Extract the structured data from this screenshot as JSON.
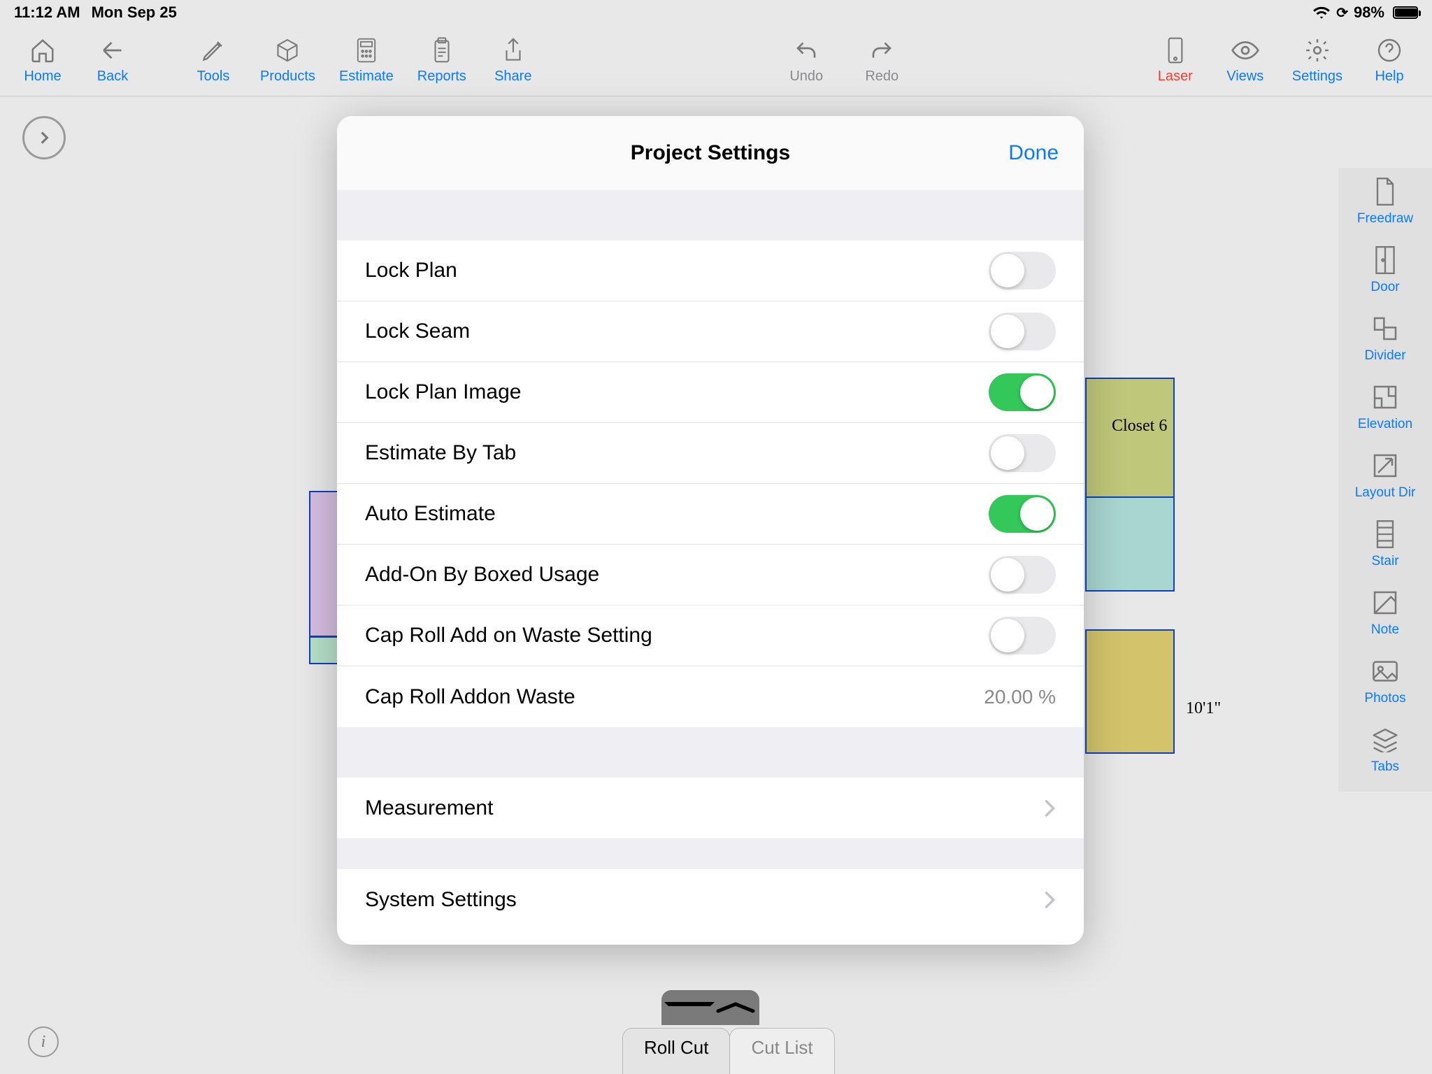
{
  "status": {
    "time": "11:12 AM",
    "date": "Mon Sep 25",
    "battery_pct": "98%"
  },
  "toolbar": {
    "home": "Home",
    "back": "Back",
    "tools": "Tools",
    "products": "Products",
    "estimate": "Estimate",
    "reports": "Reports",
    "share": "Share",
    "undo": "Undo",
    "redo": "Redo",
    "laser": "Laser",
    "views": "Views",
    "settings": "Settings",
    "help": "Help"
  },
  "rail": {
    "freedraw": "Freedraw",
    "door": "Door",
    "divider": "Divider",
    "elevation": "Elevation",
    "layoutdir": "Layout Dir",
    "stair": "Stair",
    "note": "Note",
    "photos": "Photos",
    "tabs": "Tabs"
  },
  "bottom": {
    "rollcut": "Roll Cut",
    "cutlist": "Cut List"
  },
  "modal": {
    "title": "Project Settings",
    "done": "Done",
    "rows": {
      "lock_plan": "Lock Plan",
      "lock_seam": "Lock Seam",
      "lock_plan_image": "Lock Plan Image",
      "estimate_by_tab": "Estimate By Tab",
      "auto_estimate": "Auto Estimate",
      "addon_boxed": "Add-On By Boxed Usage",
      "cap_roll_waste_setting": "Cap Roll Add on Waste Setting",
      "cap_roll_waste_label": "Cap Roll Addon Waste",
      "cap_roll_waste_value": "20.00 %",
      "measurement": "Measurement",
      "system_settings": "System Settings"
    },
    "toggles": {
      "lock_plan": false,
      "lock_seam": false,
      "lock_plan_image": true,
      "estimate_by_tab": false,
      "auto_estimate": true,
      "addon_boxed": false,
      "cap_roll_waste_setting": false
    }
  },
  "bg_dims": {
    "right1": "10'1\"",
    "closet": "Closet 6"
  }
}
